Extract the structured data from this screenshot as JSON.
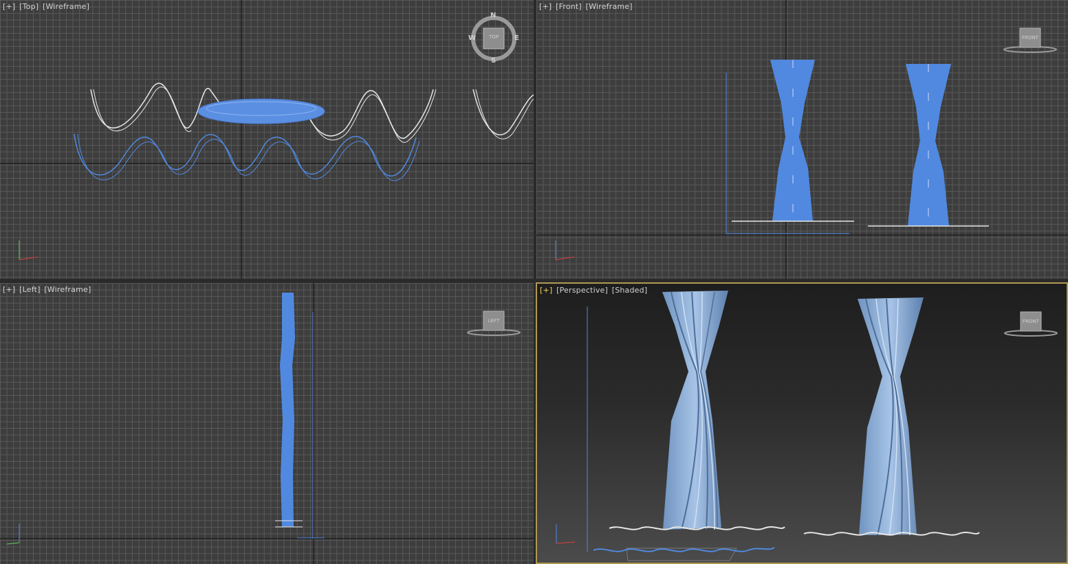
{
  "viewports": {
    "top": {
      "plus": "[+]",
      "view": "[Top]",
      "mode": "[Wireframe]"
    },
    "front": {
      "plus": "[+]",
      "view": "[Front]",
      "mode": "[Wireframe]"
    },
    "left": {
      "plus": "[+]",
      "view": "[Left]",
      "mode": "[Wireframe]"
    },
    "perspective": {
      "plus": "[+]",
      "view": "[Perspective]",
      "mode": "[Shaded]",
      "active": true
    }
  },
  "viewcube": {
    "top": {
      "face": "TOP",
      "compass": [
        "N",
        "E",
        "S",
        "W"
      ]
    },
    "front": {
      "face": "FRONT"
    },
    "left": {
      "face": "LEFT"
    },
    "perspective": {
      "face": "FRONT"
    }
  },
  "axis_labels": {
    "x": "x",
    "y": "y",
    "z": "z"
  },
  "colors": {
    "selection_blue": "#5189e0",
    "wireframe_white": "#e8e8e8",
    "grid": "#5a5a5a",
    "viewport_bg": "#3d3d3d",
    "active_border": "#b09a52",
    "curtain_shaded": "#8aaed6"
  }
}
